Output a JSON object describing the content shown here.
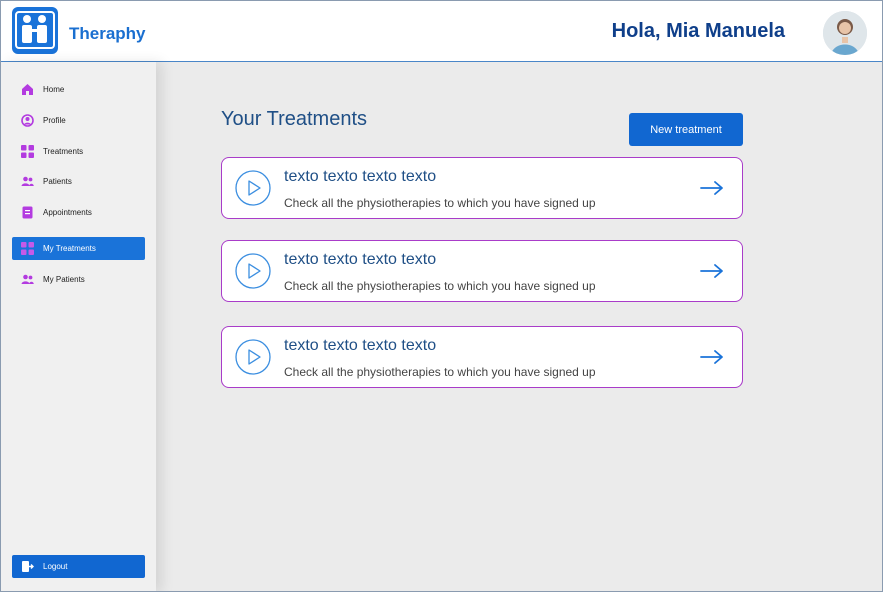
{
  "app": {
    "brand": "Theraphy",
    "greeting": "Hola, Mia Manuela"
  },
  "sidebar": {
    "items": [
      {
        "label": "Home",
        "icon": "home-icon",
        "active": false
      },
      {
        "label": "Profile",
        "icon": "user-circle-icon",
        "active": false
      },
      {
        "label": "Treatments",
        "icon": "grid-icon",
        "active": false
      },
      {
        "label": "Patients",
        "icon": "users-icon",
        "active": false
      },
      {
        "label": "Appointments",
        "icon": "document-icon",
        "active": false
      },
      {
        "label": "My Treatments",
        "icon": "grid-icon",
        "active": true
      },
      {
        "label": "My Patients",
        "icon": "users-icon",
        "active": false
      }
    ],
    "logout_label": "Logout"
  },
  "main": {
    "title": "Your Treatments",
    "new_button_label": "New treatment",
    "cards": [
      {
        "title": "texto texto texto texto",
        "description": "Check all the physiotherapies to which you have signed up"
      },
      {
        "title": "texto texto texto texto",
        "description": "Check all the physiotherapies to which you have signed up"
      },
      {
        "title": "texto texto texto texto",
        "description": "Check all the physiotherapies to which you have signed up"
      }
    ]
  },
  "colors": {
    "primary": "#1a73d9",
    "accent": "#a93cc9",
    "heading": "#1f4f86",
    "icon_purple": "#b33be0"
  }
}
